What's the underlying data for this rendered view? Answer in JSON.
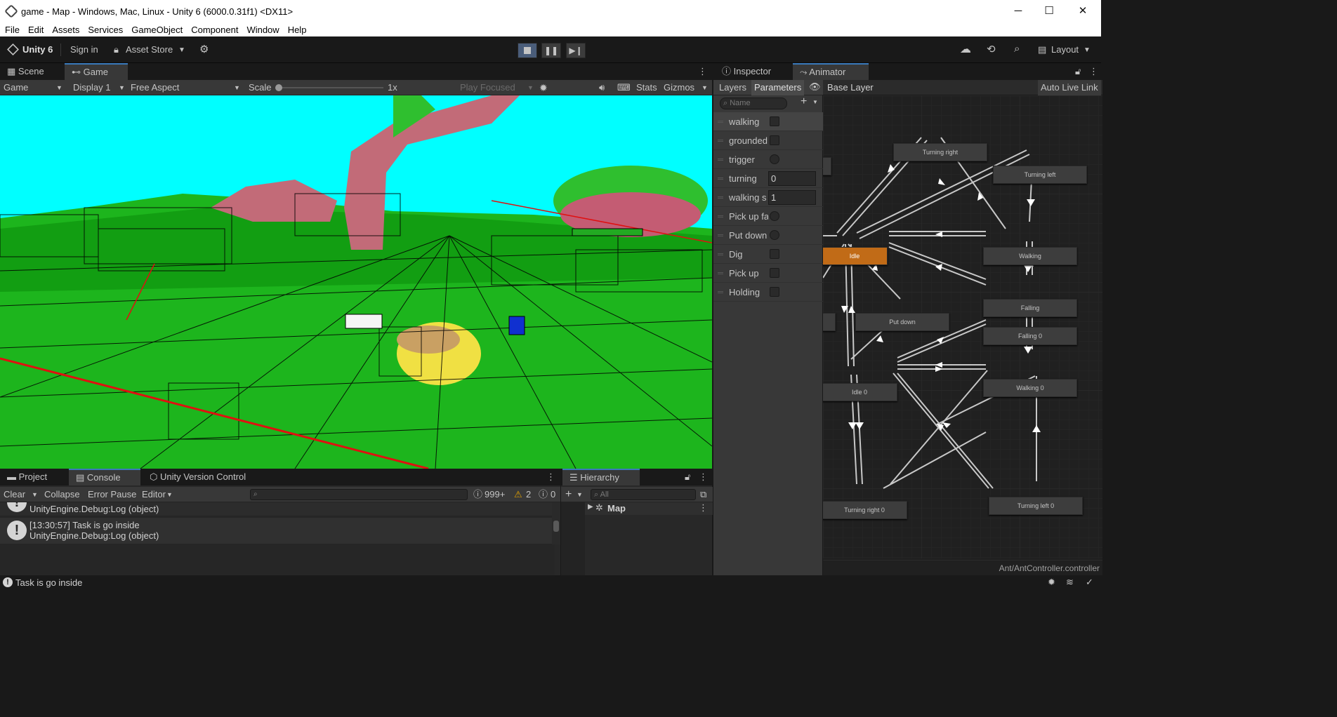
{
  "window": {
    "title": "game - Map - Windows, Mac, Linux - Unity 6 (6000.0.31f1) <DX11>",
    "minimize": "─",
    "maximize": "☐",
    "close": "✕"
  },
  "menu": [
    "File",
    "Edit",
    "Assets",
    "Services",
    "GameObject",
    "Component",
    "Window",
    "Help"
  ],
  "toolbar": {
    "unity_label": "Unity 6",
    "signin": "Sign in",
    "asset_store": "Asset Store",
    "layout": "Layout"
  },
  "game_panel": {
    "tabs": [
      {
        "label": "Scene"
      },
      {
        "label": "Game"
      }
    ],
    "controls": {
      "mode": "Game",
      "display": "Display 1",
      "aspect": "Free Aspect",
      "scale_label": "Scale",
      "scale_value": "1x",
      "play_focused": "Play Focused",
      "stats": "Stats",
      "gizmos": "Gizmos"
    }
  },
  "right_panel": {
    "tabs": [
      {
        "label": "Inspector"
      },
      {
        "label": "Animator"
      }
    ],
    "subtabs": {
      "layers": "Layers",
      "parameters": "Parameters",
      "base_layer": "Base Layer",
      "auto_live_link": "Auto Live Link"
    },
    "search_placeholder": "Name",
    "parameters": [
      {
        "name": "walking",
        "type": "bool"
      },
      {
        "name": "grounded",
        "type": "bool"
      },
      {
        "name": "trigger",
        "type": "trigger"
      },
      {
        "name": "turning",
        "type": "int",
        "value": "0"
      },
      {
        "name": "walking s",
        "type": "int",
        "value": "1"
      },
      {
        "name": "Pick up fa",
        "type": "trigger"
      },
      {
        "name": "Put down",
        "type": "trigger"
      },
      {
        "name": "Dig",
        "type": "bool"
      },
      {
        "name": "Pick up",
        "type": "bool"
      },
      {
        "name": "Holding",
        "type": "bool"
      }
    ],
    "states": [
      "Turning right",
      "Turning left",
      "Idle",
      "Walking",
      "Falling",
      "Put down",
      "Falling 0",
      "Idle 0",
      "Walking 0",
      "Turning right 0",
      "Turning left 0"
    ],
    "controller_path": "Ant/AntController.controller"
  },
  "bottom": {
    "tabs": [
      {
        "label": "Project"
      },
      {
        "label": "Console"
      },
      {
        "label": "Unity Version Control"
      }
    ],
    "console_toolbar": {
      "clear": "Clear",
      "collapse": "Collapse",
      "error_pause": "Error Pause",
      "editor": "Editor",
      "log_count": "999+",
      "warn_count": "2",
      "error_count": "0"
    },
    "log_entries": [
      {
        "line1": "",
        "line2": "UnityEngine.Debug:Log (object)"
      },
      {
        "line1": "[13:30:57] Task is go inside",
        "line2": "UnityEngine.Debug:Log (object)"
      }
    ]
  },
  "hierarchy": {
    "tab": "Hierarchy",
    "search_placeholder": "All",
    "root": "Map"
  },
  "status": {
    "message": "Task is go inside"
  }
}
